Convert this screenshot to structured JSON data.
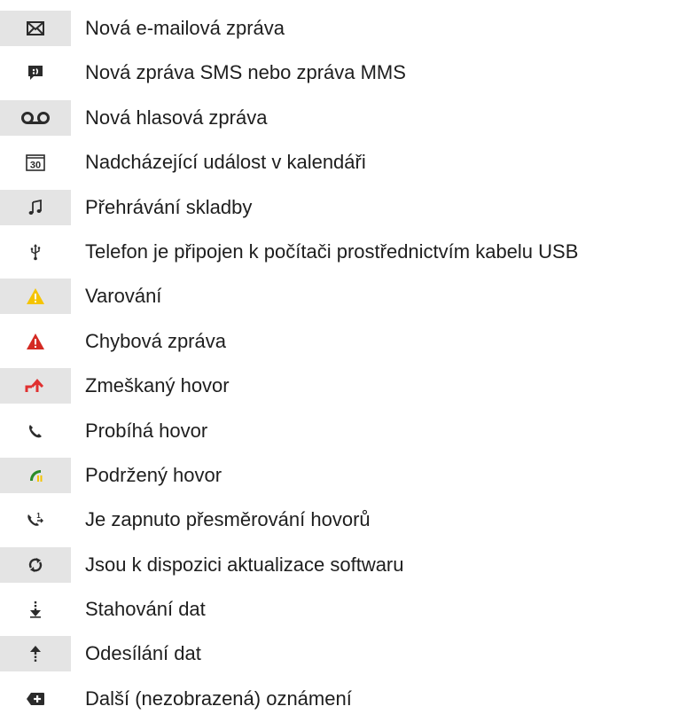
{
  "items": [
    {
      "icon": "email-icon",
      "label": "Nová e-mailová zpráva"
    },
    {
      "icon": "sms-mms-icon",
      "label": "Nová zpráva SMS nebo zpráva MMS"
    },
    {
      "icon": "voicemail-icon",
      "label": "Nová hlasová zpráva"
    },
    {
      "icon": "calendar-icon",
      "label": "Nadcházející událost v kalendáři",
      "icon_text": "30"
    },
    {
      "icon": "music-note-icon",
      "label": "Přehrávání skladby"
    },
    {
      "icon": "usb-icon",
      "label": "Telefon je připojen k počítači prostřednictvím kabelu USB"
    },
    {
      "icon": "warning-icon",
      "label": "Varování"
    },
    {
      "icon": "error-icon",
      "label": "Chybová zpráva"
    },
    {
      "icon": "missed-call-icon",
      "label": "Zmeškaný hovor"
    },
    {
      "icon": "call-in-progress-icon",
      "label": "Probíhá hovor"
    },
    {
      "icon": "call-on-hold-icon",
      "label": "Podržený hovor"
    },
    {
      "icon": "call-forwarding-icon",
      "label": "Je zapnuto přesměrování hovorů",
      "icon_text": "1"
    },
    {
      "icon": "software-update-icon",
      "label": "Jsou k dispozici aktualizace softwaru"
    },
    {
      "icon": "download-icon",
      "label": "Stahování dat"
    },
    {
      "icon": "upload-icon",
      "label": "Odesílání dat"
    },
    {
      "icon": "more-notifications-icon",
      "label": "Další (nezobrazená) oznámení"
    }
  ],
  "colors": {
    "shade": "#e4e4e4",
    "icon": "#2b2b2b",
    "warning": "#f5c400",
    "error": "#d42a23",
    "missed_call": "#e03030",
    "call_hold": "#2a8c2a",
    "text": "#1e1e1e"
  }
}
